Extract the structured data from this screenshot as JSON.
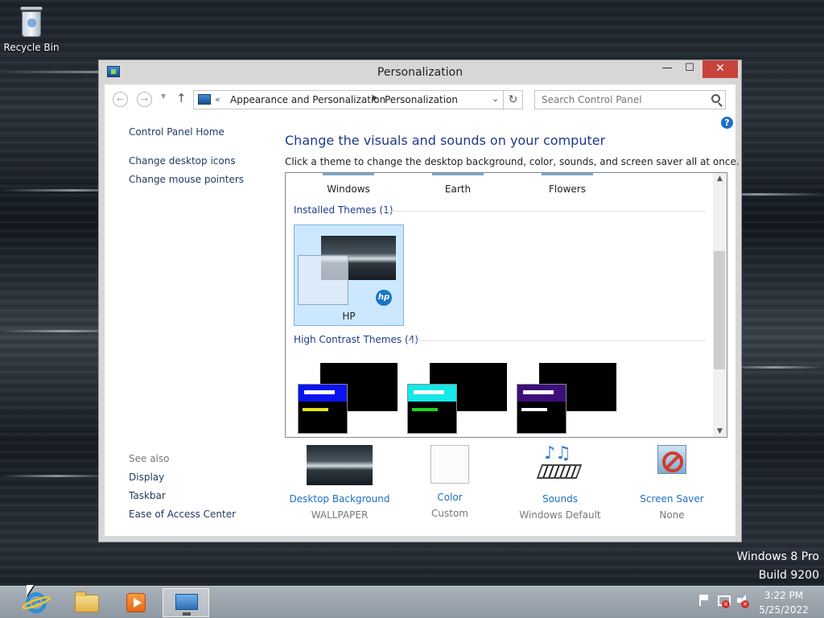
{
  "desktop": {
    "recycle_bin_label": "Recycle Bin",
    "watermark_line1": "Windows 8 Pro",
    "watermark_line2": "Build 9200"
  },
  "window": {
    "title": "Personalization",
    "controls": {
      "minimize": "—",
      "maximize": "☐",
      "close": "✕"
    }
  },
  "navbar": {
    "back_icon": "←",
    "forward_icon": "→",
    "up_icon": "↑",
    "breadcrumb_chevron": "«",
    "breadcrumbs": [
      "Appearance and Personalization",
      "Personalization"
    ],
    "refresh_icon": "↻",
    "search_placeholder": "Search Control Panel"
  },
  "left_pane": {
    "home": "Control Panel Home",
    "links": [
      "Change desktop icons",
      "Change mouse pointers"
    ],
    "see_also_label": "See also",
    "see_also": [
      "Display",
      "Taskbar",
      "Ease of Access Center"
    ]
  },
  "main": {
    "heading": "Change the visuals and sounds on your computer",
    "subtext": "Click a theme to change the desktop background, color, sounds, and screen saver all at once.",
    "top_themes": [
      "Windows",
      "Earth",
      "Flowers"
    ],
    "installed_group": "Installed Themes (1)",
    "installed_theme": "HP",
    "hp_logo_text": "hp",
    "high_contrast_group": "High Contrast Themes (4)",
    "high_contrast_themes": [
      {
        "bar_color": "#0a14f0",
        "line_color": "#e5e51a"
      },
      {
        "bar_color": "#15e8e8",
        "line_color": "#22d322"
      },
      {
        "bar_color": "#3c0f7a",
        "line_color": "#ffffff"
      }
    ]
  },
  "bottom": [
    {
      "label": "Desktop Background",
      "value": "WALLPAPER"
    },
    {
      "label": "Color",
      "value": "Custom"
    },
    {
      "label": "Sounds",
      "value": "Windows Default"
    },
    {
      "label": "Screen Saver",
      "value": "None"
    }
  ],
  "taskbar": {
    "apps": [
      "internet-explorer-icon",
      "file-explorer-icon",
      "media-player-icon",
      "control-panel-icon"
    ],
    "time": "3:22 PM",
    "date": "5/25/2022"
  }
}
